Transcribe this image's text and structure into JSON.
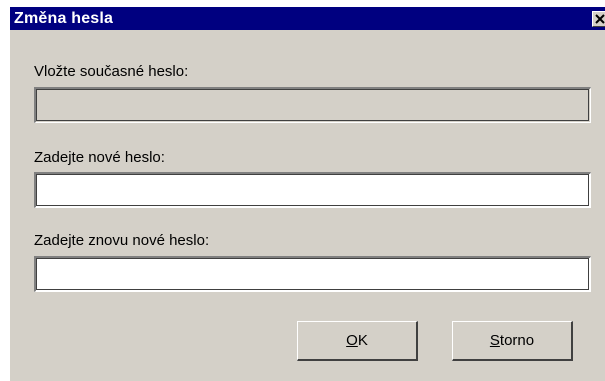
{
  "dialog": {
    "title": "Změna hesla",
    "close_icon": "close-icon",
    "colors": {
      "titlebar": "#000080",
      "title_text": "#ffffff",
      "face": "#d4d0c8"
    }
  },
  "fields": {
    "current_password": {
      "label": "Vložte současné heslo:",
      "value": "",
      "enabled": false
    },
    "new_password": {
      "label": "Zadejte nové heslo:",
      "value": "",
      "enabled": true
    },
    "confirm_password": {
      "label": "Zadejte znovu nové heslo:",
      "value": "",
      "enabled": true
    }
  },
  "buttons": {
    "ok": {
      "accel": "O",
      "rest": "K"
    },
    "cancel": {
      "accel": "S",
      "rest": "torno"
    }
  }
}
